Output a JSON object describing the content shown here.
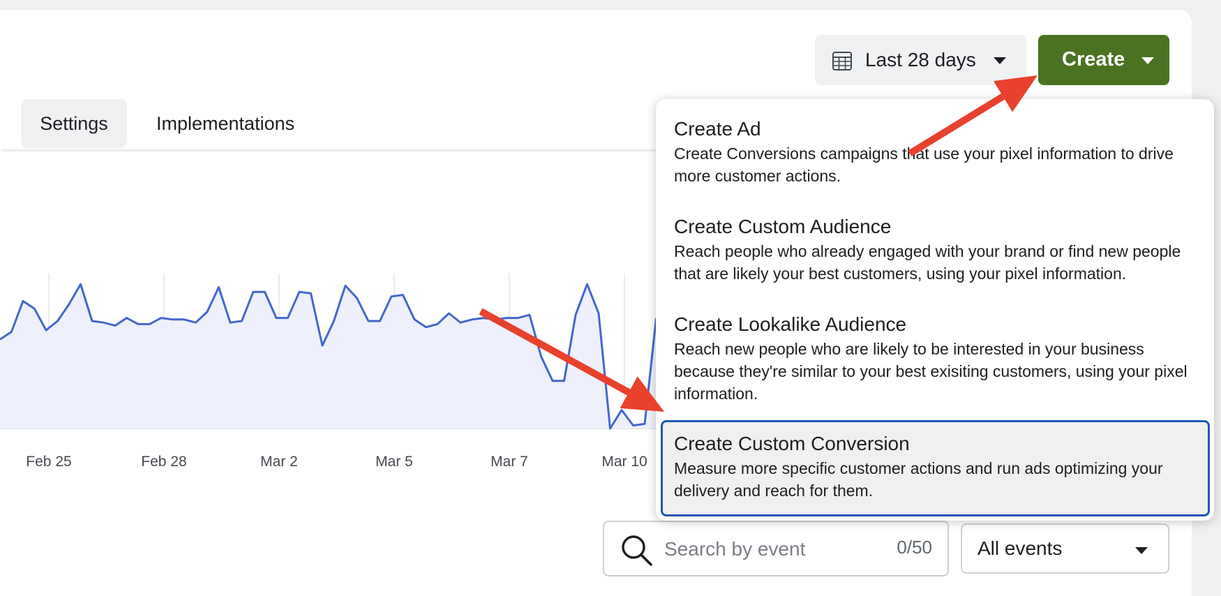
{
  "tabs": [
    {
      "label": "Settings"
    },
    {
      "label": "Implementations"
    }
  ],
  "date_range": {
    "label": "Last 28 days",
    "icon": "calendar-icon"
  },
  "create_button": {
    "label": "Create",
    "color": "#4a7223"
  },
  "chart_data": {
    "type": "area",
    "color": "#4266cc",
    "fill": "#eef1fb",
    "x_tick_labels": [
      "Feb 25",
      "Feb 28",
      "Mar 2",
      "Mar 5",
      "Mar 7",
      "Mar 10"
    ],
    "values": [
      58,
      63,
      83,
      78,
      64,
      70,
      81,
      94,
      70,
      69,
      67,
      72,
      68,
      68,
      72,
      71,
      71,
      69,
      76,
      92,
      69,
      70,
      89,
      89,
      72,
      72,
      89,
      88,
      54,
      70,
      93,
      85,
      70,
      70,
      86,
      87,
      71,
      66,
      68,
      75,
      69,
      71,
      72,
      71,
      72,
      72,
      74,
      47,
      31,
      31,
      74,
      94,
      75,
      0,
      12,
      2,
      3,
      72
    ]
  },
  "menu": {
    "items": [
      {
        "title": "Create Ad",
        "description": "Create Conversions campaigns that use your pixel information to drive more customer actions."
      },
      {
        "title": "Create Custom Audience",
        "description": "Reach people who already engaged with your brand or find new people that are likely your best customers, using your pixel information."
      },
      {
        "title": "Create Lookalike Audience",
        "description": "Reach new people who are likely to be interested in your business because they're similar to your best exisiting customers, using your pixel information."
      },
      {
        "title": "Create Custom Conversion",
        "description": "Measure more specific customer actions and run ads optimizing your delivery and reach for them."
      }
    ]
  },
  "search": {
    "placeholder": "Search by event",
    "count": "0/50",
    "icon": "search-icon"
  },
  "events_filter": {
    "label": "All events"
  },
  "annotation_color": "#e8412c"
}
